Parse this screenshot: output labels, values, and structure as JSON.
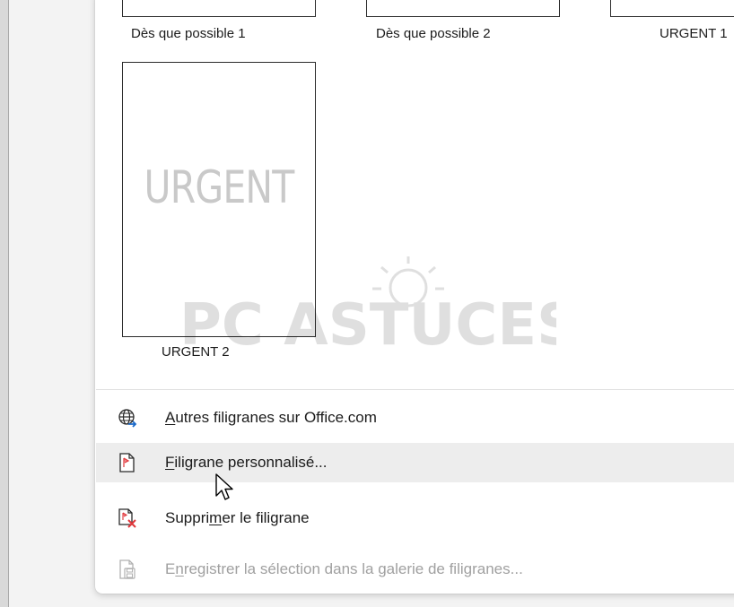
{
  "gallery": {
    "top_row": [
      {
        "label": "Dès que possible 1"
      },
      {
        "label": "Dès que possible 2"
      },
      {
        "label": "URGENT 1"
      }
    ],
    "items": [
      {
        "label": "URGENT 2",
        "preview_text": "URGENT"
      }
    ]
  },
  "menu": {
    "items": [
      {
        "key_letter": "A",
        "rest": "utres filigranes sur Office.com",
        "icon": "globe-icon",
        "state": "normal"
      },
      {
        "key_letter": "F",
        "rest": "iligrane personnalisé...",
        "icon": "custom-watermark-icon",
        "state": "hover"
      },
      {
        "pre": "Suppri",
        "key_letter": "m",
        "rest": "er le filigrane",
        "icon": "remove-watermark-icon",
        "state": "normal"
      },
      {
        "pre": "E",
        "key_letter": "n",
        "rest": "registrer la sélection dans la galerie de filigranes...",
        "icon": "save-to-gallery-icon",
        "state": "disabled"
      }
    ]
  },
  "brand_watermark": {
    "text": "PC ASTUCES"
  },
  "colors": {
    "background": "#f3f3f3",
    "panel": "#ffffff",
    "hover_row": "#ededed",
    "watermark_gray": "#c9c9c9",
    "accent_blue": "#1b6ac9",
    "remove_red": "#e0363a",
    "disabled_text": "#a0a0a0"
  }
}
